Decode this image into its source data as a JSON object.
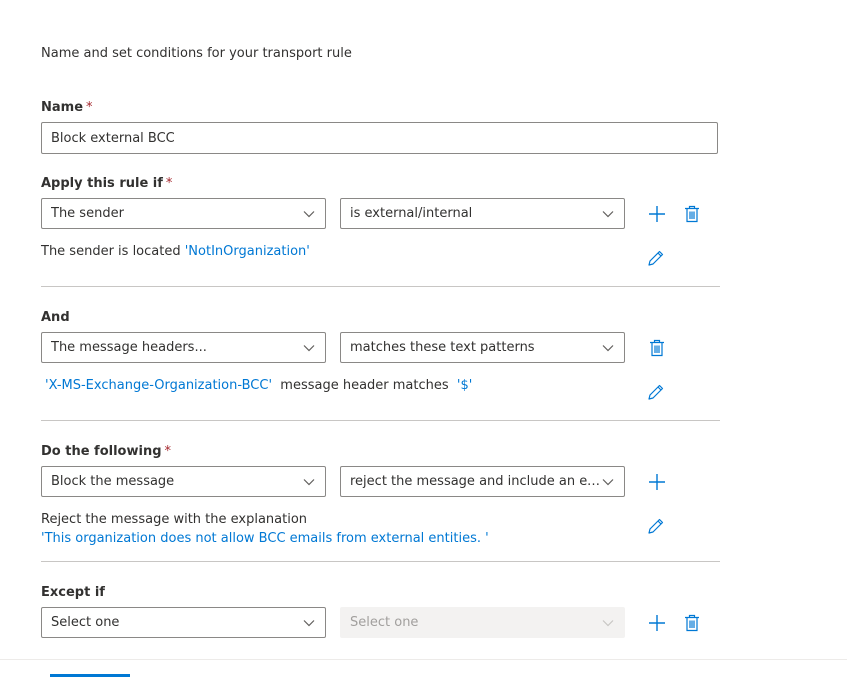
{
  "intro": "Name and set conditions for your transport rule",
  "name_section": {
    "label": "Name",
    "required_mark": "*",
    "value": "Block external BCC"
  },
  "apply_section": {
    "label": "Apply this rule if",
    "required_mark": "*",
    "property": "The sender",
    "condition": "is external/internal",
    "description_prefix": "The sender is located ",
    "description_value": "'NotInOrganization'"
  },
  "and_section": {
    "label": "And",
    "property": "The message headers...",
    "condition": "matches these text patterns",
    "header_name": "'X-MS-Exchange-Organization-BCC'",
    "middle_text": "message header matches",
    "pattern": "'$'"
  },
  "action_section": {
    "label": "Do the following",
    "required_mark": "*",
    "action": "Block the message",
    "detail": "reject the message and include an exp...",
    "description": "Reject the message with the explanation",
    "explanation": "'This organization does not allow BCC emails from external entities. '"
  },
  "except_section": {
    "label": "Except if",
    "property": "Select one",
    "condition": "Select one"
  },
  "icons": {
    "add": "add-icon",
    "delete": "delete-icon",
    "edit": "edit-pencil-icon",
    "dropdown": "chevron-down-icon"
  },
  "colors": {
    "accent": "#0078d4",
    "required": "#a4262c",
    "text": "#323130",
    "border": "#8a8886",
    "disabled_bg": "#f3f2f1",
    "disabled_text": "#a19f9d"
  }
}
